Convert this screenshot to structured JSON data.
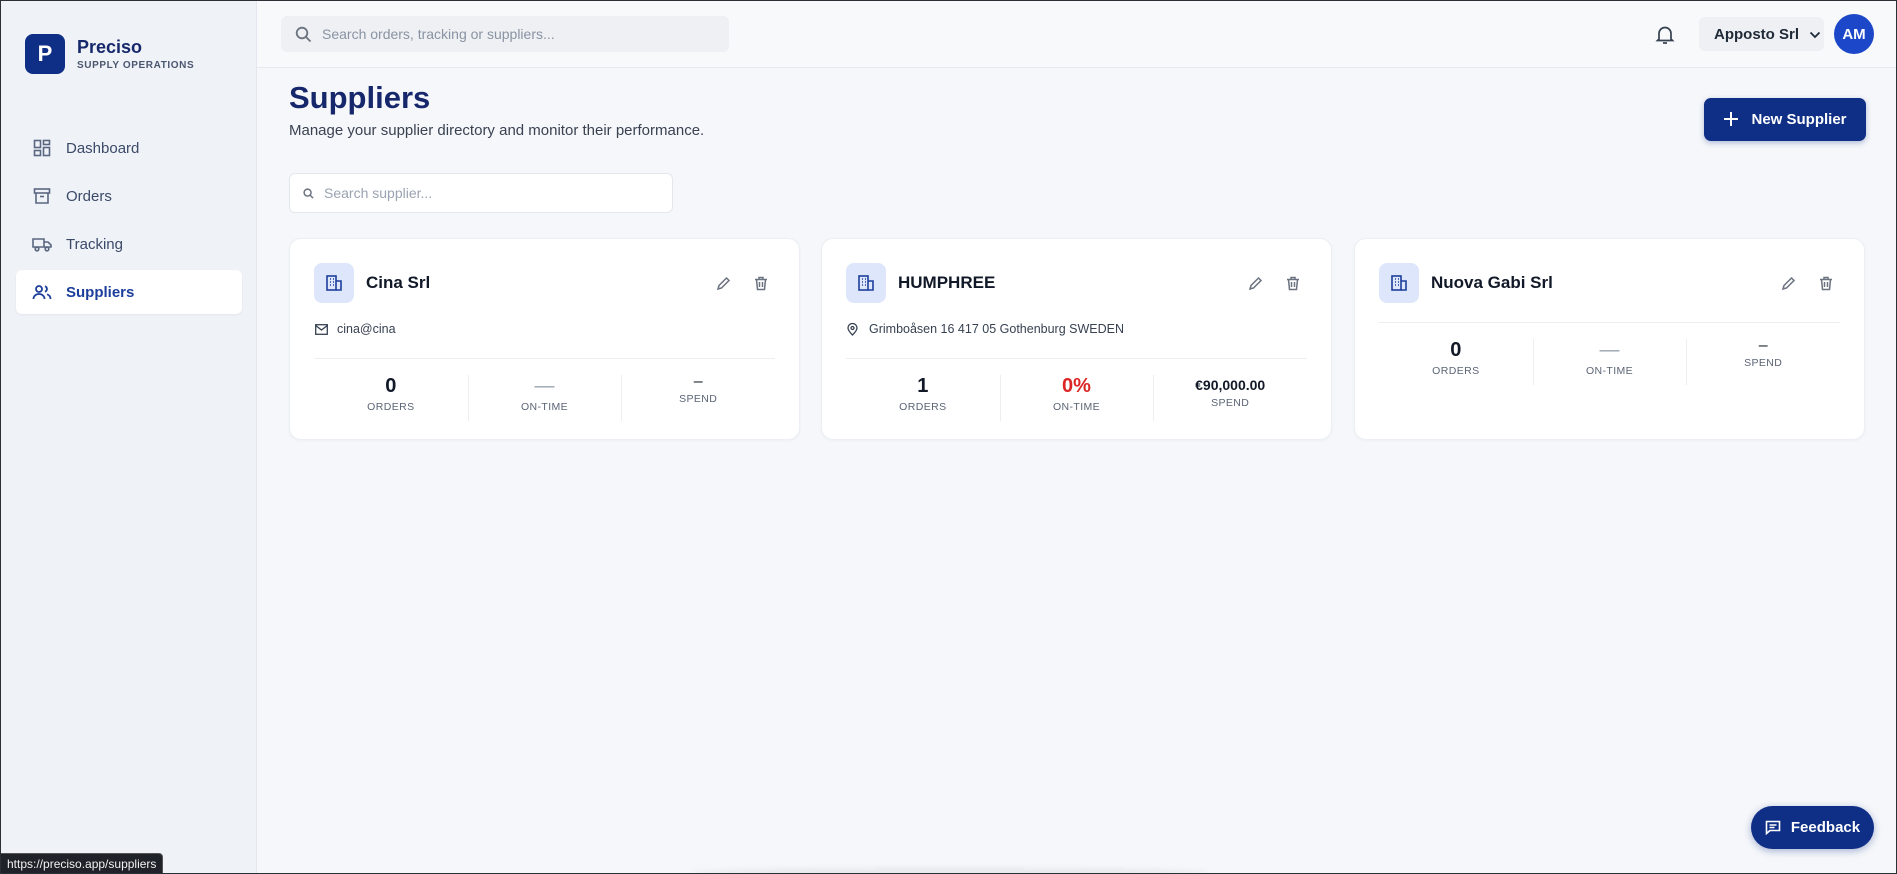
{
  "brand": {
    "logo_letter": "P",
    "name": "Preciso",
    "subtitle": "SUPPLY OPERATIONS"
  },
  "sidebar": {
    "items": [
      {
        "label": "Dashboard",
        "icon": "dashboard-grid-icon",
        "active": false
      },
      {
        "label": "Orders",
        "icon": "archive-box-icon",
        "active": false
      },
      {
        "label": "Tracking",
        "icon": "truck-icon",
        "active": false
      },
      {
        "label": "Suppliers",
        "icon": "users-icon",
        "active": true
      }
    ]
  },
  "topbar": {
    "search_placeholder": "Search orders, tracking or suppliers...",
    "organization": "Apposto Srl",
    "avatar_initials": "AM"
  },
  "page": {
    "title": "Suppliers",
    "subtitle": "Manage your supplier directory and monitor their performance.",
    "new_button_label": "New Supplier",
    "search_placeholder": "Search supplier..."
  },
  "suppliers": [
    {
      "name": "Cina Srl",
      "contact_icon": "mail-icon",
      "contact": "cina@cina",
      "orders": "0",
      "orders_label": "ORDERS",
      "ontime": "—",
      "ontime_label": "ON-TIME",
      "spend": "–",
      "spend_label": "SPEND"
    },
    {
      "name": "HUMPHREE",
      "contact_icon": "map-pin-icon",
      "contact": "Grimboåsen 16 417 05 Gothenburg SWEDEN",
      "orders": "1",
      "orders_label": "ORDERS",
      "ontime": "0%",
      "ontime_label": "ON-TIME",
      "spend": "€90,000.00",
      "spend_label": "SPEND"
    },
    {
      "name": "Nuova Gabi Srl",
      "contact_icon": "",
      "contact": "",
      "orders": "0",
      "orders_label": "ORDERS",
      "ontime": "—",
      "ontime_label": "ON-TIME",
      "spend": "–",
      "spend_label": "SPEND"
    }
  ],
  "feedback_label": "Feedback",
  "status_url": "https://preciso.app/suppliers",
  "colors": {
    "brand_navy": "#0f2f86",
    "accent_blue": "#1c47c8",
    "danger_red": "#dc2626"
  }
}
